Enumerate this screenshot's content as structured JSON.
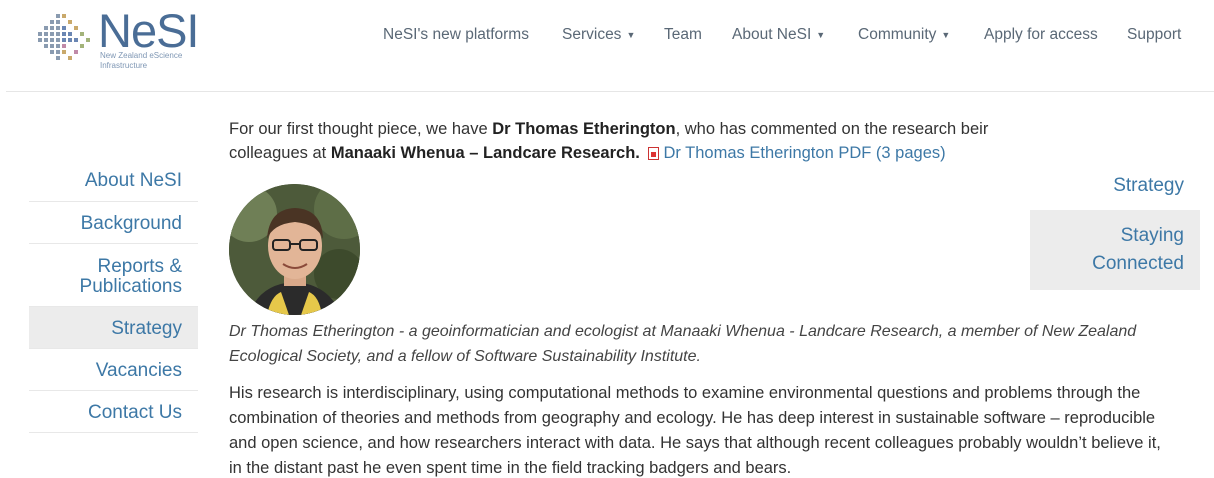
{
  "brand": {
    "name": "NeSI",
    "subtitle_line1": "New Zealand eScience",
    "subtitle_line2": "Infrastructure",
    "color": "#4a6d96"
  },
  "nav": {
    "items": [
      {
        "label": "NeSI's new platforms",
        "has_caret": false
      },
      {
        "label": "Services",
        "has_caret": true
      },
      {
        "label": "Team",
        "has_caret": false
      },
      {
        "label": "About NeSI",
        "has_caret": true
      },
      {
        "label": "Community",
        "has_caret": true
      },
      {
        "label": "Apply for access",
        "has_caret": false
      },
      {
        "label": "Support",
        "has_caret": false
      }
    ]
  },
  "sidebar_left": {
    "items": [
      {
        "label": "About NeSI",
        "active": false
      },
      {
        "label": "Background",
        "active": false
      },
      {
        "label_line1": "Reports &",
        "label_line2": "Publications",
        "active": false
      },
      {
        "label": "Strategy",
        "active": true
      },
      {
        "label": "Vacancies",
        "active": false
      },
      {
        "label": "Contact Us",
        "active": false
      }
    ]
  },
  "sidebar_right": {
    "items": [
      {
        "label": "Strategy",
        "active": false
      },
      {
        "label_line1": "Staying",
        "label_line2": "Connected",
        "active": true
      }
    ]
  },
  "main": {
    "intro_part1": "For our first thought piece, we have ",
    "intro_name": "Dr Thomas Etherington",
    "intro_part2": ", who has commented on the research beir",
    "intro_part3": "colleagues at ",
    "intro_org": "Manaaki Whenua – Landcare Research.",
    "pdf_link": "Dr Thomas Etherington PDF (3 pages)",
    "caption": "Dr Thomas Etherington - a geoinformatician and ecologist at Manaaki Whenua - Landcare Research, a member of New Zealand Ecological Society, and a fellow of Software Sustainability Institute.",
    "body": "His research is interdisciplinary, using computational methods to examine environmental questions and problems through the combination of theories and methods from geography and ecology. He has deep interest in sustainable software – reproducible and open science, and how researchers interact with data. He says that although recent colleagues probably wouldn’t believe it, in the distant past he even spent time in the field tracking badgers and bears."
  },
  "colors": {
    "link": "#3d78a6",
    "active_bg": "#ececec",
    "nav_text": "#5a6876"
  }
}
